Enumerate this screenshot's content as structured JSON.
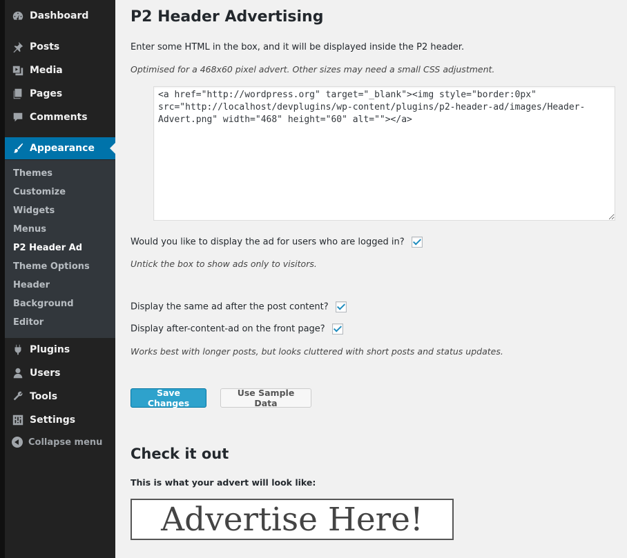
{
  "sidebar": {
    "top_items": [
      {
        "label": "Dashboard",
        "icon": "dashboard-icon"
      },
      {
        "label": "Posts",
        "icon": "pin-icon"
      },
      {
        "label": "Media",
        "icon": "media-icon"
      },
      {
        "label": "Pages",
        "icon": "pages-icon"
      },
      {
        "label": "Comments",
        "icon": "comment-icon"
      },
      {
        "label": "Appearance",
        "icon": "paintbrush-icon"
      }
    ],
    "submenu": [
      "Themes",
      "Customize",
      "Widgets",
      "Menus",
      "P2 Header Ad",
      "Theme Options",
      "Header",
      "Background",
      "Editor"
    ],
    "bottom_items": [
      {
        "label": "Plugins",
        "icon": "plugin-icon"
      },
      {
        "label": "Users",
        "icon": "user-icon"
      },
      {
        "label": "Tools",
        "icon": "wrench-icon"
      },
      {
        "label": "Settings",
        "icon": "settings-icon"
      }
    ],
    "collapse_label": "Collapse menu",
    "accent_color": "#0073aa"
  },
  "main": {
    "title": "P2 Header Advertising",
    "intro": "Enter some HTML in the box, and it will be displayed inside the P2 header.",
    "hint": "Optimised for a 468x60 pixel advert. Other sizes may need a small CSS adjustment.",
    "html_value": "<a href=\"http://wordpress.org\" target=\"_blank\"><img style=\"border:0px\" src=\"http://localhost/devplugins/wp-content/plugins/p2-header-ad/images/Header-Advert.png\" width=\"468\" height=\"60\" alt=\"\"></a>",
    "logged_in_label": "Would you like to display the ad for users who are logged in?",
    "logged_in_note": "Untick the box to show ads only to visitors.",
    "after_post_label": "Display the same ad after the post content?",
    "front_page_label": "Display after-content-ad on the front page?",
    "after_note": "Works best with longer posts, but looks cluttered with short posts and status updates.",
    "save_button": "Save Changes",
    "sample_button": "Use Sample Data",
    "preview_title": "Check it out",
    "preview_label": "This is what your advert will look like:",
    "advert_text": "Advertise Here!"
  }
}
